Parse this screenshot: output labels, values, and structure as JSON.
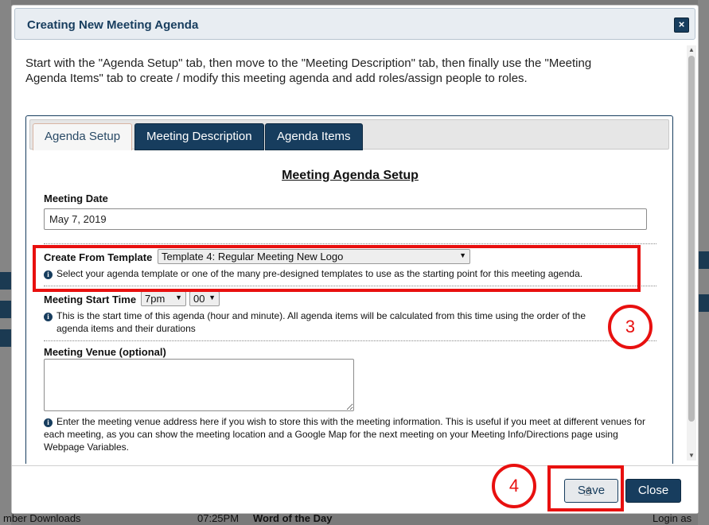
{
  "background": {
    "bottom_time": "07:25PM",
    "bottom_title": "Word of the Day",
    "bottom_left": "mber Downloads",
    "bottom_right": "Login as"
  },
  "dialog": {
    "title": "Creating New Meeting Agenda",
    "close_glyph": "×",
    "intro": "Start with the \"Agenda Setup\" tab, then move to the \"Meeting Description\" tab, then finally use the \"Meeting Agenda Items\" tab to create / modify this meeting agenda and add roles/assign people to roles.",
    "tabs": [
      {
        "label": "Agenda Setup",
        "active": true
      },
      {
        "label": "Meeting Description",
        "active": false
      },
      {
        "label": "Agenda Items",
        "active": false
      }
    ],
    "section_title": "Meeting Agenda Setup",
    "meeting_date": {
      "label": "Meeting Date",
      "value": "May 7, 2019"
    },
    "template": {
      "label": "Create From Template",
      "selected": "Template 4: Regular Meeting New Logo",
      "hint": "Select your agenda template or one of the many pre-designed templates to use as the starting point for this meeting agenda."
    },
    "start_time": {
      "label": "Meeting Start Time",
      "hour": "7pm",
      "minute": "00",
      "hint_line1": "This is the start time of this agenda (hour and minute). All agenda items will be calculated from this time using the order of the",
      "hint_line2": "agenda items and their durations"
    },
    "venue": {
      "label": "Meeting Venue (optional)",
      "value": "",
      "hint": "Enter the meeting venue address here if you wish to store this with the meeting information. This is useful if you meet at different venues for each meeting, as you can show the meeting location and a Google Map for the next meeting on your Meeting Info/Directions page using Webpage Variables."
    },
    "buttons": {
      "save": "Save",
      "close": "Close"
    }
  },
  "annotations": {
    "step3": "3",
    "step4": "4",
    "highlight_color": "#e8100f"
  },
  "colors": {
    "accent": "#173d5e",
    "annotation": "#e8100f"
  }
}
